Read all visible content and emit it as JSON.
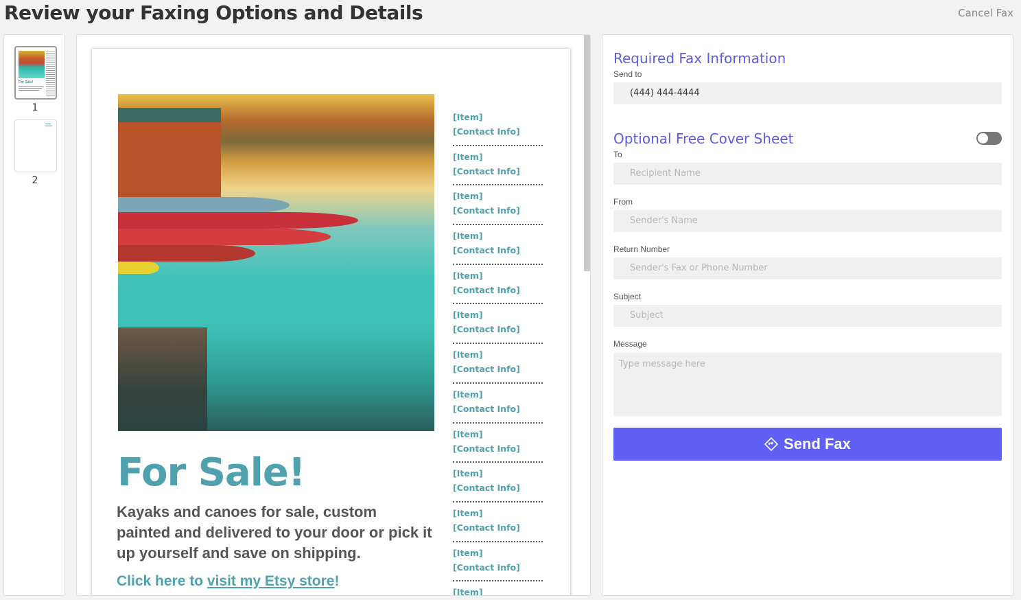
{
  "header": {
    "title": "Review your Faxing Options and Details",
    "cancel_label": "Cancel Fax"
  },
  "thumbnails": [
    {
      "number": "1",
      "title": "For Sale!"
    },
    {
      "number": "2"
    }
  ],
  "document": {
    "headline": "For Sale!",
    "description": "Kayaks and canoes for sale, custom painted and delivered to your door or pick it up yourself and save on shipping.",
    "etsy_prefix": "Click here to ",
    "etsy_link": "visit my Etsy store",
    "etsy_suffix": "!",
    "items": [
      {
        "item": "[Item]",
        "contact": "[Contact Info]"
      },
      {
        "item": "[Item]",
        "contact": "[Contact Info]"
      },
      {
        "item": "[Item]",
        "contact": "[Contact Info]"
      },
      {
        "item": "[Item]",
        "contact": "[Contact Info]"
      },
      {
        "item": "[Item]",
        "contact": "[Contact Info]"
      },
      {
        "item": "[Item]",
        "contact": "[Contact Info]"
      },
      {
        "item": "[Item]",
        "contact": "[Contact Info]"
      },
      {
        "item": "[Item]",
        "contact": "[Contact Info]"
      },
      {
        "item": "[Item]",
        "contact": "[Contact Info]"
      },
      {
        "item": "[Item]",
        "contact": "[Contact Info]"
      },
      {
        "item": "[Item]",
        "contact": "[Contact Info]"
      },
      {
        "item": "[Item]",
        "contact": "[Contact Info]"
      },
      {
        "item": "[Item]",
        "contact": ""
      }
    ]
  },
  "form": {
    "required_title": "Required Fax Information",
    "send_to_label": "Send to",
    "send_to_value": "(444) 444-4444",
    "cover_title": "Optional Free Cover Sheet",
    "cover_enabled": false,
    "to_label": "To",
    "to_placeholder": "Recipient Name",
    "from_label": "From",
    "from_placeholder": "Sender's Name",
    "return_label": "Return Number",
    "return_placeholder": "Sender's Fax or Phone Number",
    "subject_label": "Subject",
    "subject_placeholder": "Subject",
    "message_label": "Message",
    "message_placeholder": "Type message here",
    "send_label": "Send Fax"
  },
  "colors": {
    "accent": "#6060f7",
    "title_blue": "#5b5be0",
    "doc_teal": "#4ea1ad"
  }
}
